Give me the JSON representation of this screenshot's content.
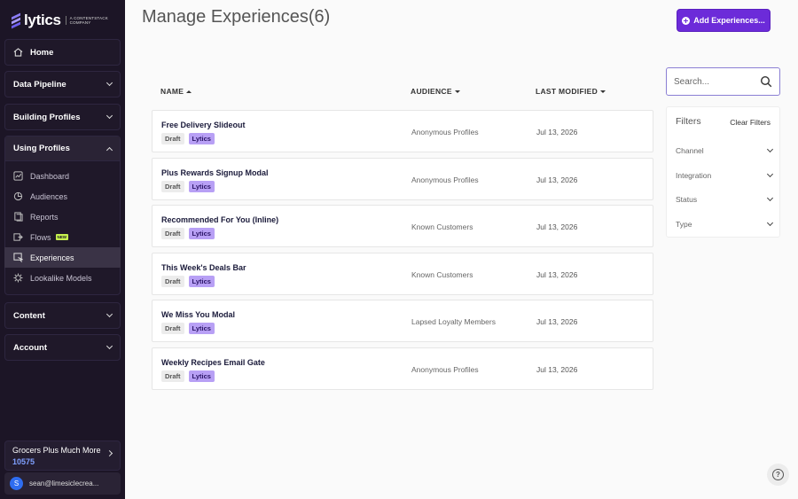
{
  "brand": {
    "name": "lytics",
    "sub_line1": "A CONTENTSTACK",
    "sub_line2": "COMPANY"
  },
  "sidebar": {
    "home": "Home",
    "sections": [
      {
        "label": "Data Pipeline"
      },
      {
        "label": "Building Profiles"
      },
      {
        "label": "Using Profiles"
      },
      {
        "label": "Content"
      },
      {
        "label": "Account"
      }
    ],
    "using_profiles_items": [
      {
        "label": "Dashboard"
      },
      {
        "label": "Audiences"
      },
      {
        "label": "Reports"
      },
      {
        "label": "Flows",
        "badge": "NEW"
      },
      {
        "label": "Experiences"
      },
      {
        "label": "Lookalike Models"
      }
    ],
    "org_name": "Grocers Plus Much More",
    "org_id": "10575",
    "user_initial": "S",
    "user_email": "sean@limesiclecrea..."
  },
  "main": {
    "title": "Manage Experiences(6)",
    "add_button": "Add Experiences...",
    "columns": {
      "name": "NAME",
      "audience": "AUDIENCE",
      "modified": "LAST MODIFIED"
    },
    "rows": [
      {
        "name": "Free Delivery Slideout",
        "status": "Draft",
        "provider": "Lytics",
        "audience": "Anonymous Profiles",
        "modified": "Jul 13, 2026"
      },
      {
        "name": "Plus Rewards Signup Modal",
        "status": "Draft",
        "provider": "Lytics",
        "audience": "Anonymous Profiles",
        "modified": "Jul 13, 2026"
      },
      {
        "name": "Recommended For You (Inline)",
        "status": "Draft",
        "provider": "Lytics",
        "audience": "Known Customers",
        "modified": "Jul 13, 2026"
      },
      {
        "name": "This Week's Deals Bar",
        "status": "Draft",
        "provider": "Lytics",
        "audience": "Known Customers",
        "modified": "Jul 13, 2026"
      },
      {
        "name": "We Miss You Modal",
        "status": "Draft",
        "provider": "Lytics",
        "audience": "Lapsed Loyalty Members",
        "modified": "Jul 13, 2026"
      },
      {
        "name": "Weekly Recipes Email Gate",
        "status": "Draft",
        "provider": "Lytics",
        "audience": "Anonymous Profiles",
        "modified": "Jul 13, 2026"
      }
    ]
  },
  "search": {
    "placeholder": "Search..."
  },
  "filters": {
    "title": "Filters",
    "clear": "Clear Filters",
    "items": [
      {
        "label": "Channel"
      },
      {
        "label": "Integration"
      },
      {
        "label": "Status"
      },
      {
        "label": "Type"
      }
    ]
  },
  "help": {
    "glyph": "?"
  },
  "colors": {
    "sidebar_bg": "#1c1526",
    "accent": "#6c2bd9",
    "tag_lytics": "#b8a0f5"
  }
}
